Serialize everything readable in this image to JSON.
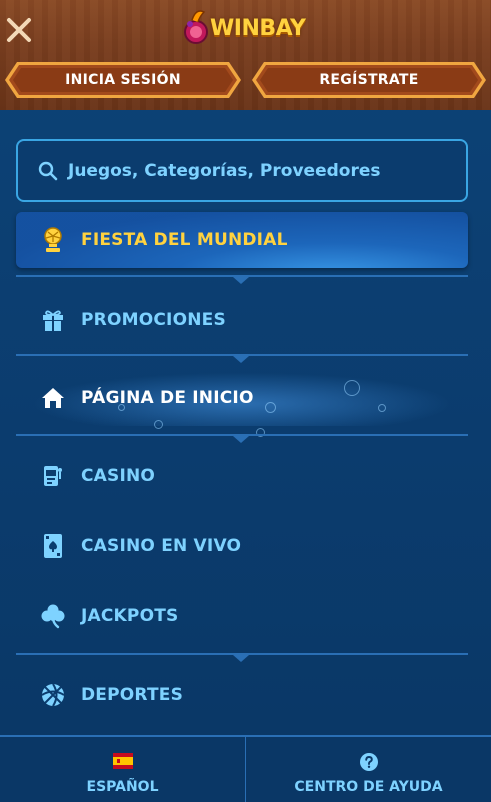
{
  "header": {
    "logo_text": "WINBAY",
    "login_label": "INICIA SESIÓN",
    "register_label": "REGÍSTRATE"
  },
  "search": {
    "placeholder": "Juegos, Categorías, Proveedores"
  },
  "menu": {
    "items": [
      {
        "label": "FIESTA DEL MUNDIAL",
        "icon": "trophy-icon"
      },
      {
        "label": "PROMOCIONES",
        "icon": "gift-icon"
      },
      {
        "label": "PÁGINA DE INICIO",
        "icon": "home-icon"
      },
      {
        "label": "CASINO",
        "icon": "slot-machine-icon"
      },
      {
        "label": "CASINO EN VIVO",
        "icon": "playing-card-icon"
      },
      {
        "label": "JACKPOTS",
        "icon": "clover-icon"
      },
      {
        "label": "DEPORTES",
        "icon": "ball-icon"
      }
    ]
  },
  "footer": {
    "language_label": "ESPAÑOL",
    "help_label": "CENTRO DE AYUDA"
  },
  "colors": {
    "accent_gold": "#ffd23f",
    "text_cyan": "#7ed2ff",
    "panel_blue": "#0b3c6e",
    "header_wood": "#7a3e1f"
  }
}
